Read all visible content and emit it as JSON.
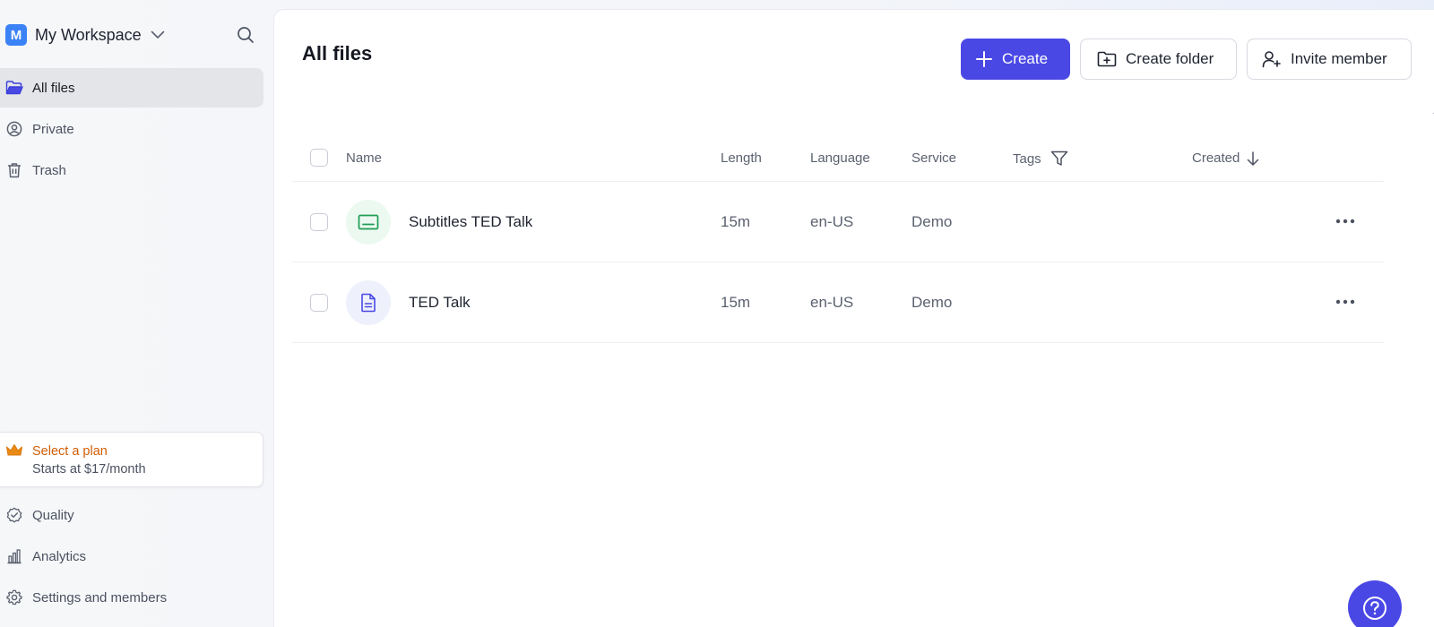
{
  "workspace": {
    "badge": "M",
    "name": "My Workspace"
  },
  "sidebar": {
    "nav": [
      {
        "label": "All files",
        "icon": "folder-open-icon",
        "active": true
      },
      {
        "label": "Private",
        "icon": "user-circle-icon"
      },
      {
        "label": "Trash",
        "icon": "trash-icon"
      }
    ],
    "plan": {
      "title": "Select a plan",
      "subtitle": "Starts at $17/month",
      "icon": "crown-icon"
    },
    "bottom_nav": [
      {
        "label": "Quality",
        "icon": "badge-check-icon"
      },
      {
        "label": "Analytics",
        "icon": "bar-chart-icon"
      },
      {
        "label": "Settings and members",
        "icon": "gear-icon"
      }
    ]
  },
  "main": {
    "title": "All files",
    "buttons": {
      "create": "Create",
      "create_folder": "Create folder",
      "invite_member": "Invite member"
    },
    "columns": {
      "name": "Name",
      "length": "Length",
      "language": "Language",
      "service": "Service",
      "tags": "Tags",
      "created": "Created"
    },
    "rows": [
      {
        "name": "Subtitles TED Talk",
        "length": "15m",
        "language": "en-US",
        "service": "Demo",
        "icon": "subtitles-icon"
      },
      {
        "name": "TED Talk",
        "length": "15m",
        "language": "en-US",
        "service": "Demo",
        "icon": "document-icon"
      }
    ]
  },
  "colors": {
    "accent": "#4a48e5",
    "workspace_badge": "#3b82f6",
    "plan_text": "#d15e05",
    "subtitle_icon": "#1f9d55",
    "document_icon": "#4a48e5"
  }
}
